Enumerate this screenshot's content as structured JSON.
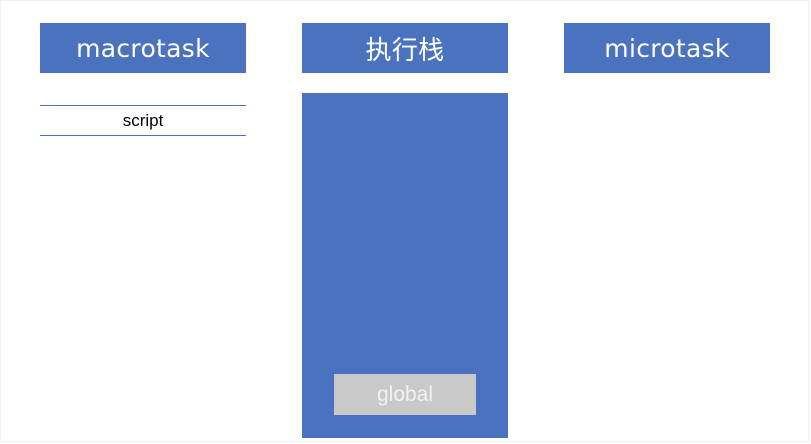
{
  "macrotask": {
    "title": "macrotask",
    "items": [
      "script"
    ]
  },
  "call_stack": {
    "title": "执行栈",
    "frames": [
      "global"
    ]
  },
  "microtask": {
    "title": "microtask",
    "items": []
  },
  "colors": {
    "header_fill": "#4a72be",
    "stack_fill": "#4a72be",
    "frame_fill": "#c9c9c9",
    "divider": "#4a72be"
  }
}
